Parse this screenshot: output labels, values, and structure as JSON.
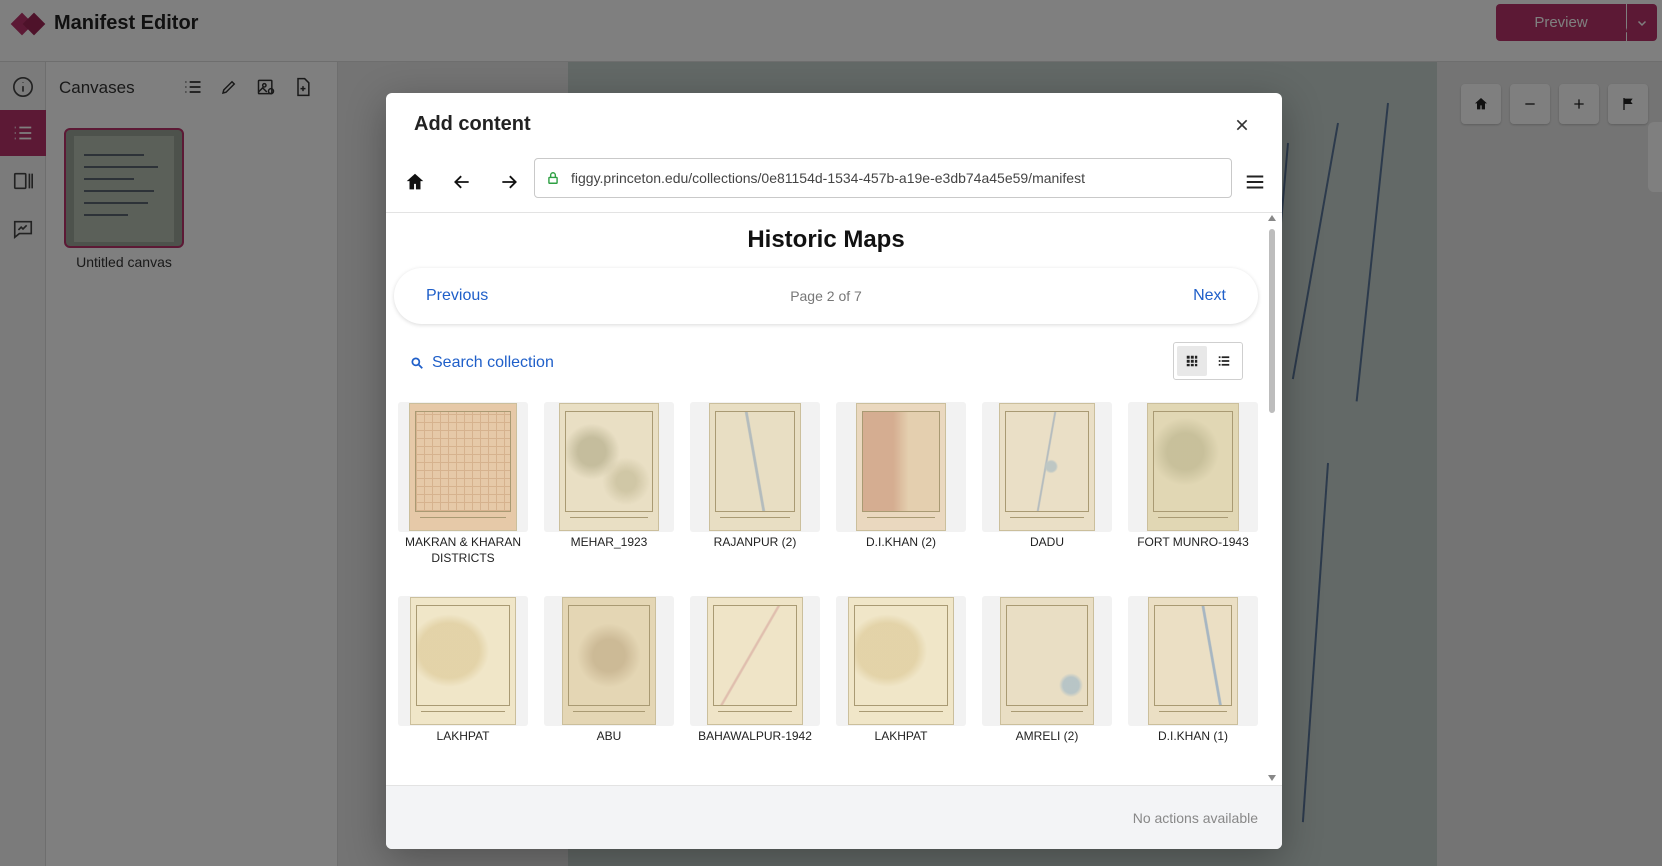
{
  "app": {
    "name": "Manifest Editor",
    "preview_label": "Preview"
  },
  "canvases": {
    "title": "Canvases",
    "items": [
      {
        "label": "Untitled canvas"
      }
    ]
  },
  "modal": {
    "title": "Add content",
    "url": "figgy.princeton.edu/collections/0e81154d-1534-457b-a19e-e3db74a45e59/manifest",
    "collection_title": "Historic Maps",
    "pager": {
      "previous": "Previous",
      "info": "Page 2 of 7",
      "next": "Next"
    },
    "search_label": "Search collection",
    "view_mode": "grid",
    "items": [
      {
        "label": "MAKRAN & KHARAN DISTRICTS"
      },
      {
        "label": "MEHAR_1923"
      },
      {
        "label": "RAJANPUR (2)"
      },
      {
        "label": "D.I.KHAN (2)"
      },
      {
        "label": "DADU"
      },
      {
        "label": "FORT MUNRO-1943"
      },
      {
        "label": "LAKHPAT"
      },
      {
        "label": "ABU"
      },
      {
        "label": "BAHAWALPUR-1942"
      },
      {
        "label": "LAKHPAT"
      },
      {
        "label": "AMRELI (2)"
      },
      {
        "label": "D.I.KHAN (1)"
      }
    ],
    "footer_text": "No actions available"
  },
  "colors": {
    "accent": "#b8336a",
    "link": "#1f5fc9",
    "secure": "#2ea043"
  }
}
